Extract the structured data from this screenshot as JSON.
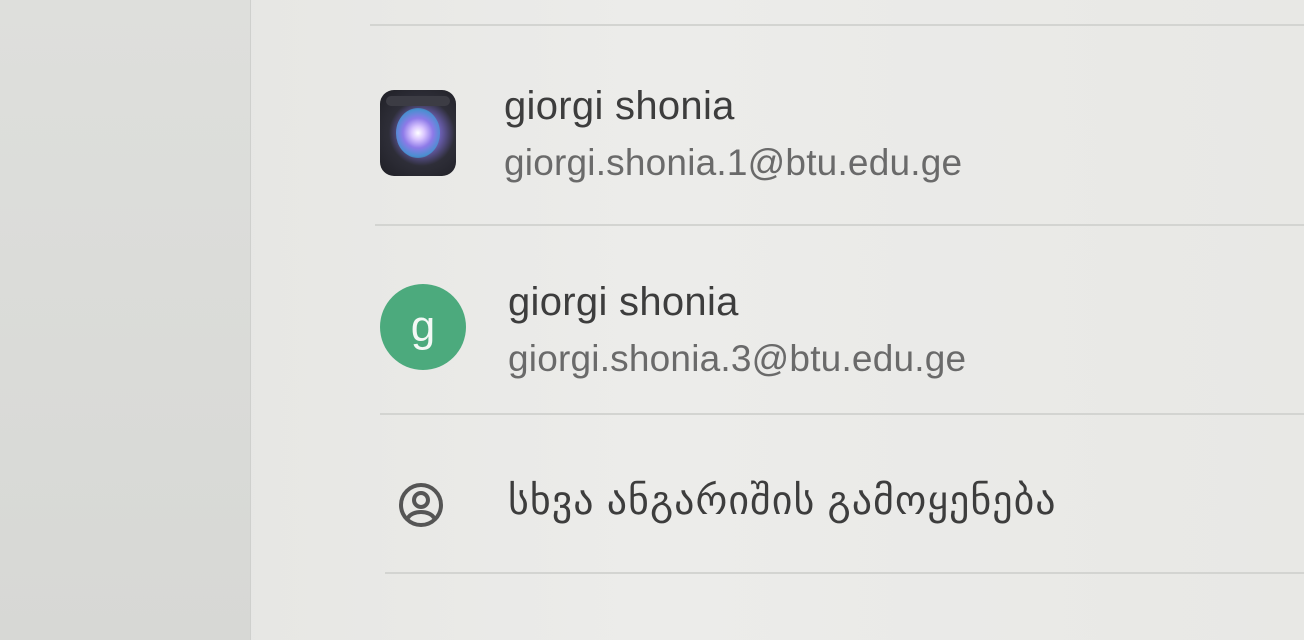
{
  "accounts": [
    {
      "name": "giorgi shonia",
      "email": "giorgi.shonia.1@btu.edu.ge",
      "avatar": "photo"
    },
    {
      "name": "giorgi shonia",
      "email": "giorgi.shonia.3@btu.edu.ge",
      "avatar_letter": "g",
      "avatar_color": "#4caa7d"
    }
  ],
  "add_account": {
    "label": "სხვა ანგარიშის გამოყენება",
    "icon": "account-circle-icon"
  }
}
